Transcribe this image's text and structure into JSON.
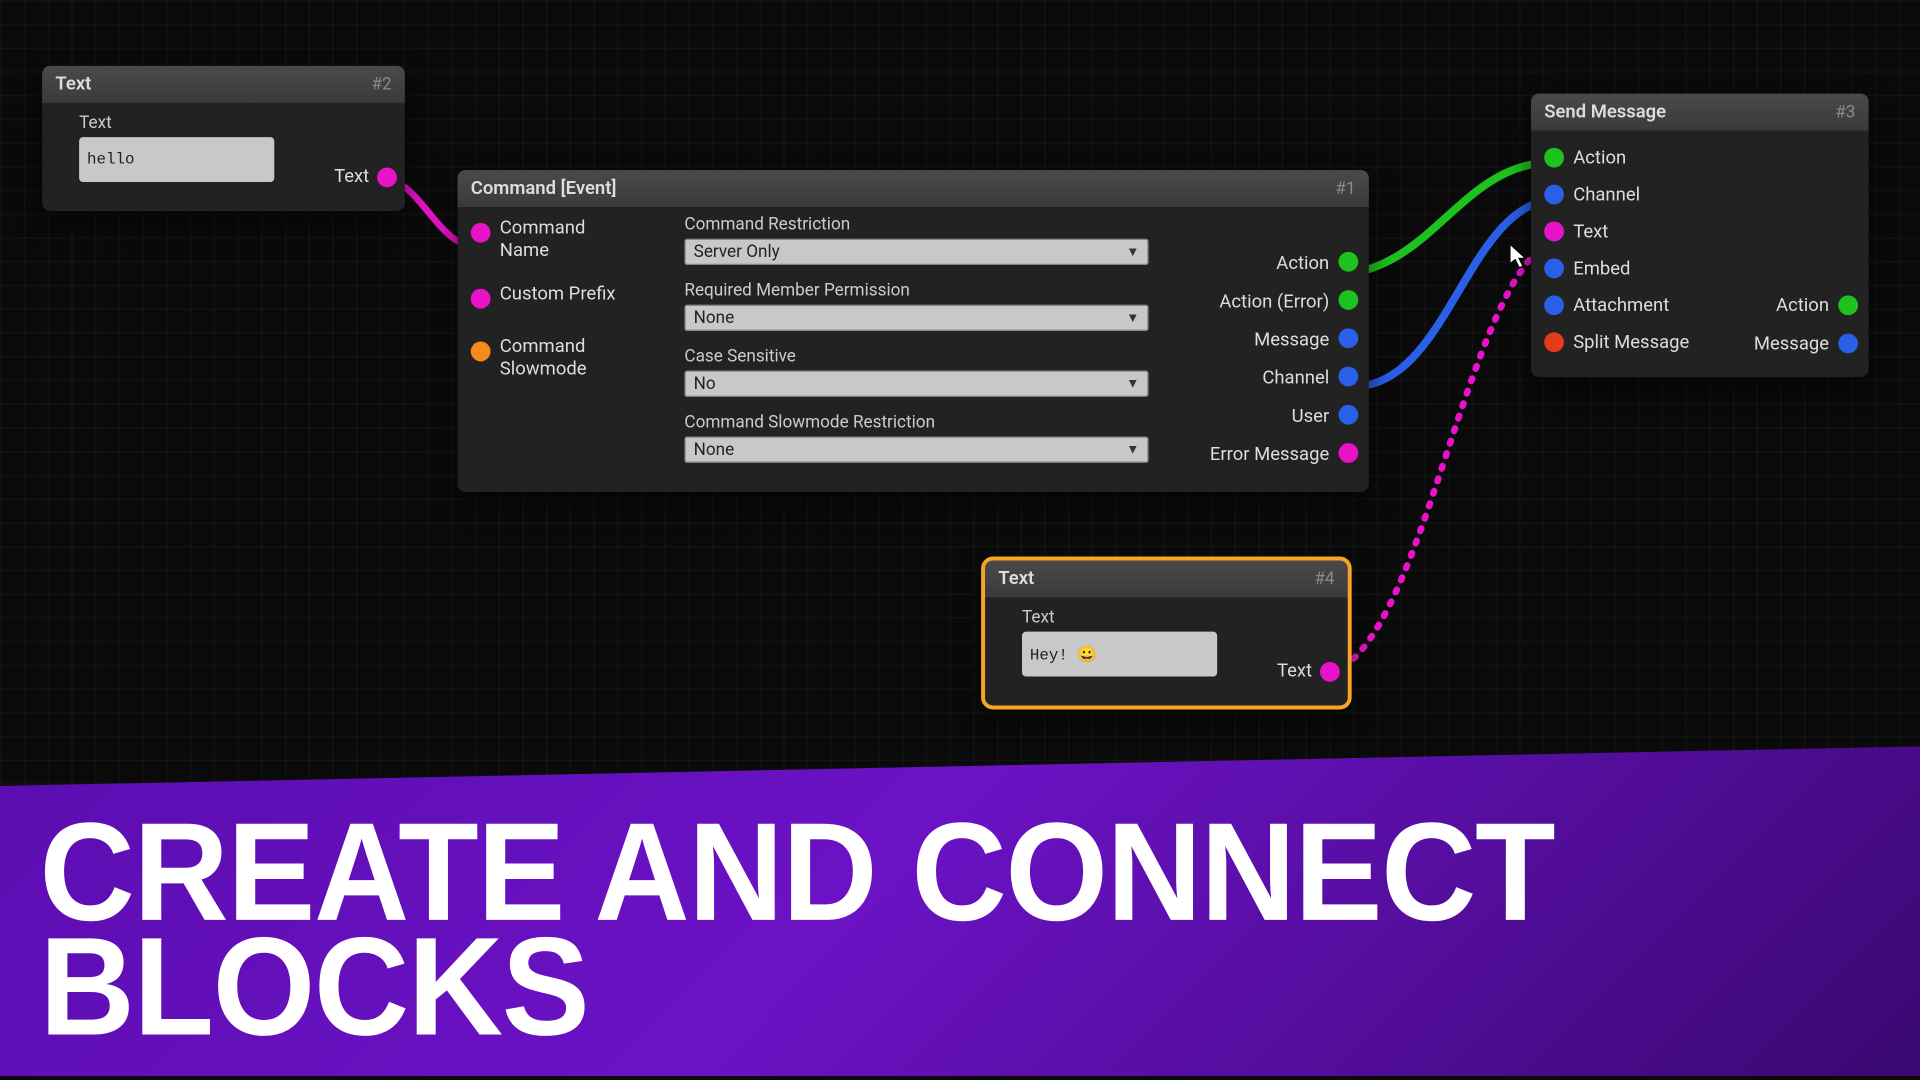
{
  "banner": {
    "headline": "CREATE AND CONNECT BLOCKS"
  },
  "nodes": {
    "text2": {
      "title": "Text",
      "id_label": "#2",
      "field_label": "Text",
      "value": "hello",
      "out_label": "Text"
    },
    "command1": {
      "title": "Command [Event]",
      "id_label": "#1",
      "inputs": {
        "command_name": "Command Name",
        "custom_prefix": "Custom Prefix",
        "command_slowmode": "Command Slowmode"
      },
      "fields": {
        "restriction_label": "Command Restriction",
        "restriction_value": "Server Only",
        "permission_label": "Required Member Permission",
        "permission_value": "None",
        "case_label": "Case Sensitive",
        "case_value": "No",
        "slowmode_label": "Command Slowmode Restriction",
        "slowmode_value": "None"
      },
      "outputs": {
        "action": "Action",
        "action_error": "Action (Error)",
        "message": "Message",
        "channel": "Channel",
        "user": "User",
        "error_message": "Error Message"
      }
    },
    "text4": {
      "title": "Text",
      "id_label": "#4",
      "field_label": "Text",
      "value": "Hey! 😀",
      "out_label": "Text"
    },
    "send3": {
      "title": "Send Message",
      "id_label": "#3",
      "inputs": {
        "action": "Action",
        "channel": "Channel",
        "text": "Text",
        "embed": "Embed",
        "attachment": "Attachment",
        "split_message": "Split Message"
      },
      "outputs": {
        "action": "Action",
        "message": "Message"
      }
    }
  },
  "colors": {
    "green": "#1ec21e",
    "blue": "#2a5fe8",
    "magenta": "#e813c9"
  }
}
